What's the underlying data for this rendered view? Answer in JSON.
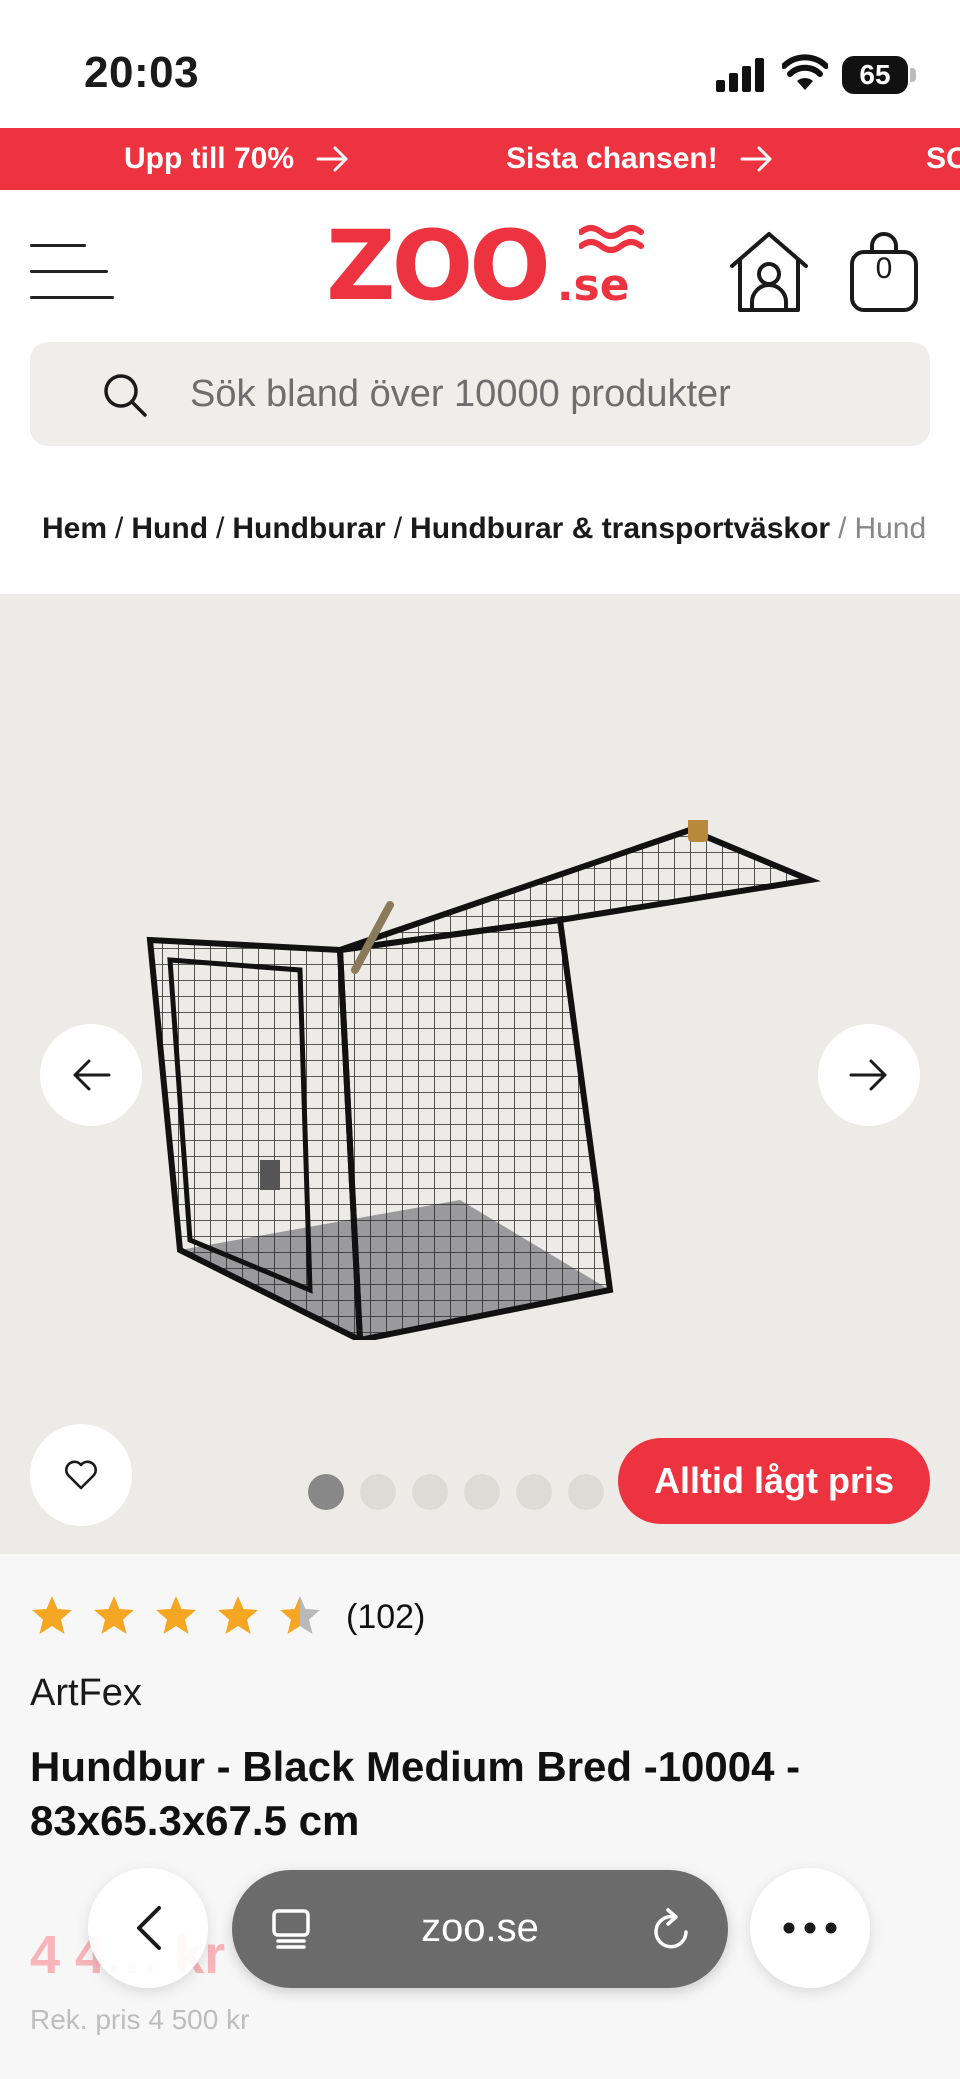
{
  "status_bar": {
    "time": "20:03",
    "battery": "65"
  },
  "promo": {
    "items": [
      {
        "label": "Upp till 70%"
      },
      {
        "label": "Sista chansen!"
      },
      {
        "label": "SO"
      }
    ]
  },
  "header": {
    "logo_main": "ZOO",
    "logo_suffix": ".se",
    "cart_count": "0"
  },
  "search": {
    "placeholder": "Sök bland över 10000 produkter"
  },
  "breadcrumb": {
    "items": [
      "Hem",
      "Hund",
      "Hundburar",
      "Hundburar & transportväskor"
    ],
    "current": "Hund"
  },
  "gallery": {
    "badge": "Alltid lågt pris",
    "image_count": 7,
    "active_index": 0
  },
  "product": {
    "rating": 4.5,
    "review_count": "(102)",
    "brand": "ArtFex",
    "title": "Hundbur - Black Medium Bred -10004 - 83x65.3x67.5 cm",
    "price": "4 4… kr",
    "recommended_price": "Rek. pris 4 500 kr"
  },
  "browser": {
    "url": "zoo.se"
  },
  "colors": {
    "accent": "#ee3340",
    "star": "#f5a623",
    "surface": "#ecebe7"
  }
}
